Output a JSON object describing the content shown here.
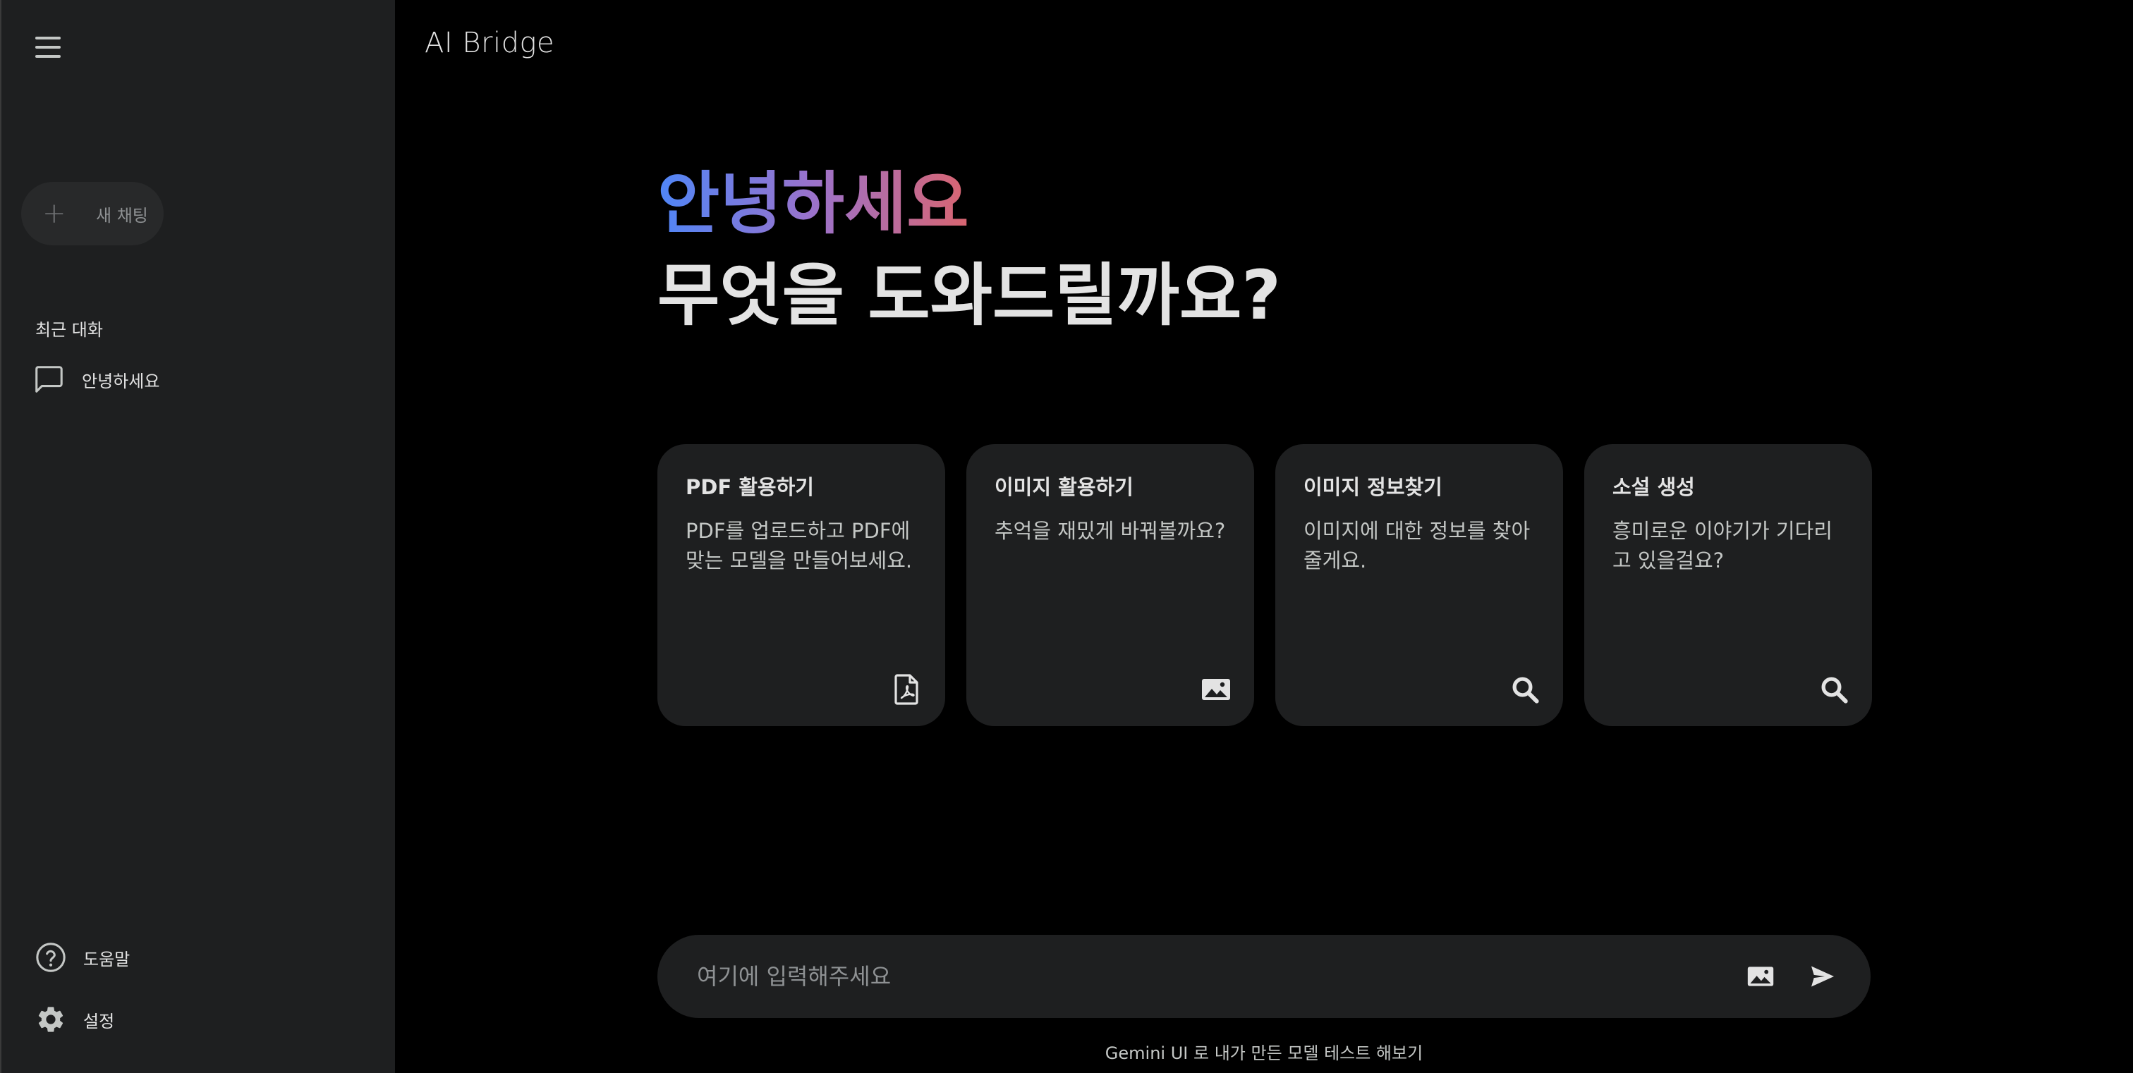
{
  "app": {
    "title": "AI Bridge"
  },
  "sidebar": {
    "new_chat_label": "새 채팅",
    "recent_section_label": "최근 대화",
    "recent_items": [
      {
        "label": "안녕하세요",
        "icon": "chat-bubble-icon"
      }
    ],
    "help_label": "도움말",
    "settings_label": "설정"
  },
  "main": {
    "greeting": "안녕하세요",
    "subheading": "무엇을 도와드릴까요?",
    "cards": [
      {
        "title": "PDF 활용하기",
        "description": "PDF를 업로드하고 PDF에 맞는 모델을 만들어보세요.",
        "icon": "pdf-icon"
      },
      {
        "title": "이미지 활용하기",
        "description": "추억을 재밌게 바꿔볼까요?",
        "icon": "image-icon"
      },
      {
        "title": "이미지 정보찾기",
        "description": "이미지에 대한 정보를 찾아 줄게요.",
        "icon": "search-icon"
      },
      {
        "title": "소설 생성",
        "description": "흥미로운 이야기가 기다리고 있을걸요?",
        "icon": "search-icon"
      }
    ],
    "input": {
      "placeholder": "여기에 입력해주세요",
      "value": ""
    },
    "footer_note": "Gemini UI 로 내가 만든 모델 테스트 해보기"
  },
  "colors": {
    "background": "#000000",
    "sidebar": "#1e1f20",
    "card": "#1e1f20",
    "greeting_gradient": [
      "#4f86f7",
      "#9b72cb",
      "#d96570"
    ]
  }
}
